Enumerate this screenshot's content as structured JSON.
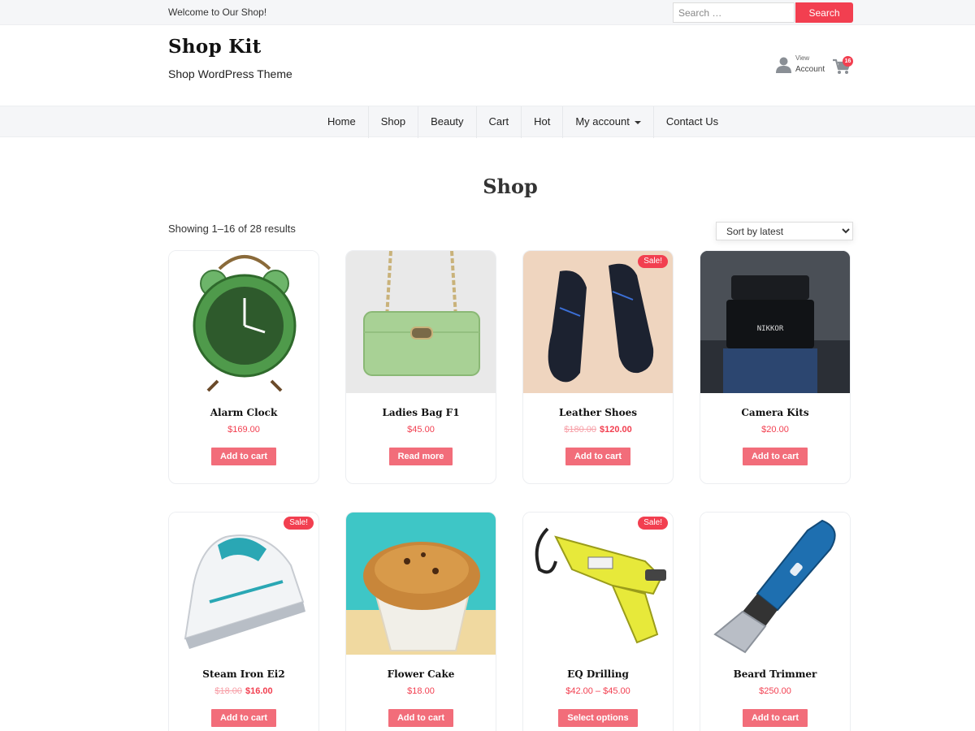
{
  "topbar": {
    "welcome": "Welcome to Our Shop!",
    "search_placeholder": "Search …",
    "search_button": "Search"
  },
  "header": {
    "site_title": "Shop Kit",
    "tagline": "Shop WordPress Theme",
    "account_small": "View",
    "account_label": "Account",
    "cart_count": "16",
    "icons": [
      "user-icon",
      "cart-icon"
    ]
  },
  "nav": {
    "items": [
      "Home",
      "Shop",
      "Beauty",
      "Cart",
      "Hot",
      "My account",
      "Contact Us"
    ]
  },
  "main": {
    "title": "Shop",
    "result_count": "Showing 1–16 of 28 results",
    "sort_selected": "Sort by latest"
  },
  "colors": {
    "accent": "#f23f50",
    "button": "#f26d7a",
    "bar_bg": "#f5f6f8"
  },
  "products": [
    {
      "name": "Alarm Clock",
      "price": "$169.00",
      "old_price": "",
      "button": "Add to cart",
      "sale": false
    },
    {
      "name": "Ladies Bag F1",
      "price": "$45.00",
      "old_price": "",
      "button": "Read more",
      "sale": false
    },
    {
      "name": "Leather Shoes",
      "price": "$120.00",
      "old_price": "$180.00",
      "button": "Add to cart",
      "sale": true
    },
    {
      "name": "Camera Kits",
      "price": "$20.00",
      "old_price": "",
      "button": "Add to cart",
      "sale": false
    },
    {
      "name": "Steam Iron Ei2",
      "price": "$16.00",
      "old_price": "$18.00",
      "button": "Add to cart",
      "sale": true
    },
    {
      "name": "Flower Cake",
      "price": "$18.00",
      "old_price": "",
      "button": "Add to cart",
      "sale": false
    },
    {
      "name": "EQ Drilling",
      "price": "$42.00 – $45.00",
      "old_price": "",
      "button": "Select options",
      "sale": true
    },
    {
      "name": "Beard Trimmer",
      "price": "$250.00",
      "old_price": "",
      "button": "Add to cart",
      "sale": false
    }
  ],
  "sale_label": "Sale!"
}
